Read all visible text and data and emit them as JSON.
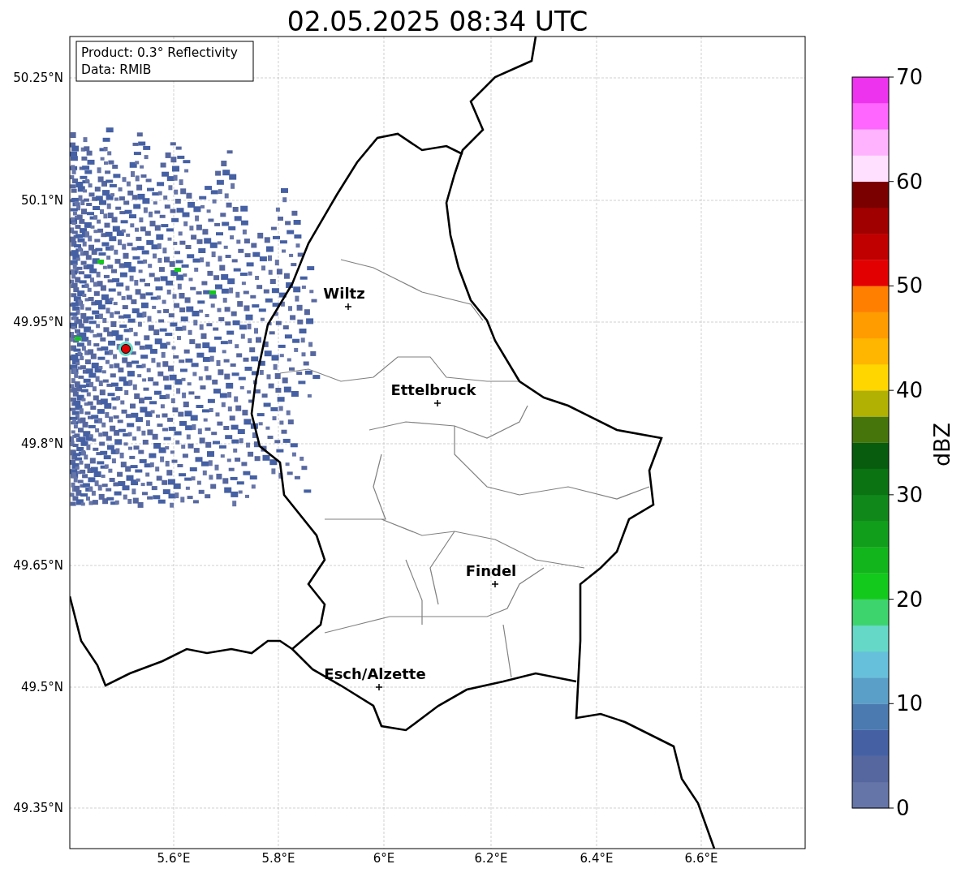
{
  "title": "02.05.2025 08:34 UTC",
  "info_box": [
    "Product: 0.3° Reflectivity",
    "Data: RMIB"
  ],
  "map": {
    "lat_labels": [
      "50.25°N",
      "50.1°N",
      "49.95°N",
      "49.8°N",
      "49.65°N",
      "49.5°N",
      "49.35°N"
    ],
    "lon_labels": [
      "5.6°E",
      "5.8°E",
      "6°E",
      "6.2°E",
      "6.4°E",
      "6.6°E"
    ],
    "cities": [
      {
        "name": "Wiltz"
      },
      {
        "name": "Ettelbruck"
      },
      {
        "name": "Findel"
      },
      {
        "name": "Esch/Alzette"
      }
    ]
  },
  "colorbar": {
    "label": "dBZ",
    "ticks": [
      "70",
      "60",
      "50",
      "40",
      "30",
      "20",
      "10",
      "0"
    ],
    "bands": [
      {
        "color": "#6675a8"
      },
      {
        "color": "#56679f"
      },
      {
        "color": "#4560a3"
      },
      {
        "color": "#4a7ab0"
      },
      {
        "color": "#5a9fc8"
      },
      {
        "color": "#66c0dc"
      },
      {
        "color": "#66d8c8"
      },
      {
        "color": "#3dd46e"
      },
      {
        "color": "#13c91c"
      },
      {
        "color": "#12b51b"
      },
      {
        "color": "#119e1a"
      },
      {
        "color": "#10891a"
      },
      {
        "color": "#0b7312"
      },
      {
        "color": "#075c0e"
      },
      {
        "color": "#46760b"
      },
      {
        "color": "#b1b104"
      },
      {
        "color": "#ffd600"
      },
      {
        "color": "#ffb600"
      },
      {
        "color": "#ff9c00"
      },
      {
        "color": "#ff7f00"
      },
      {
        "color": "#e30000"
      },
      {
        "color": "#c00000"
      },
      {
        "color": "#a00000"
      },
      {
        "color": "#7a0000"
      },
      {
        "color": "#ffe0ff"
      },
      {
        "color": "#ffb3ff"
      },
      {
        "color": "#ff66ff"
      },
      {
        "color": "#ee33ee"
      }
    ]
  }
}
